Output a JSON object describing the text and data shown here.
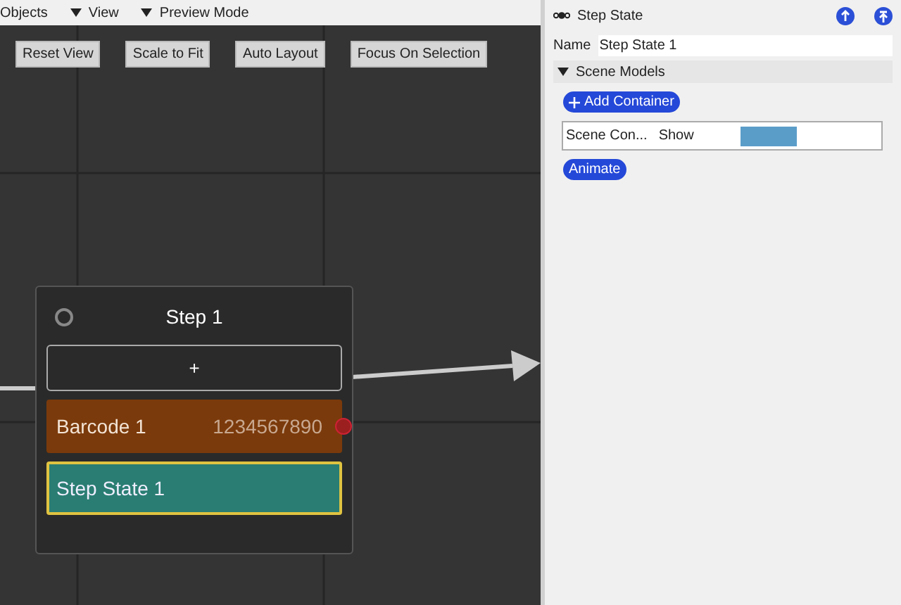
{
  "menu": [
    {
      "label": "Objects",
      "caret": false
    },
    {
      "label": "View",
      "caret": true
    },
    {
      "label": "Preview Mode",
      "caret": true
    }
  ],
  "toolbar": [
    "Reset View",
    "Scale to Fit",
    "Auto Layout",
    "Focus On Selection"
  ],
  "node": {
    "title": "Step 1",
    "add": "+",
    "items": [
      {
        "kind": "barcode",
        "label": "Barcode 1",
        "value": "1234567890",
        "selected": false
      },
      {
        "kind": "state",
        "label": "Step State 1",
        "selected": true
      }
    ]
  },
  "panel": {
    "title": "Step State",
    "name_label": "Name",
    "name_value": "Step State 1",
    "section": {
      "title": "Scene Models",
      "expanded": true
    },
    "add_button": "Add Container",
    "row": {
      "name": "Scene Con...",
      "action": "Show",
      "color": "#5b9dc9"
    },
    "animate": "Animate"
  }
}
